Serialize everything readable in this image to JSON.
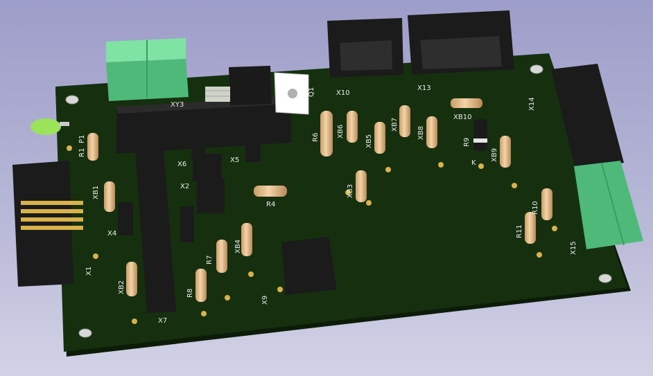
{
  "labels": {
    "X1": "X1",
    "X2": "X2",
    "X4": "X4",
    "X5": "X5",
    "X6": "X6",
    "X7": "X7",
    "X9": "X9",
    "X10": "X10",
    "X13": "X13",
    "X14": "X14",
    "X15": "X15",
    "R1": "R1",
    "P1": "P1",
    "R4": "R4",
    "R6": "R6",
    "R7": "R7",
    "R8": "R8",
    "R9": "R9",
    "R10": "R10",
    "R11": "R11",
    "Q1": "Q1",
    "K": "K",
    "XB1": "XB1",
    "XB2": "XB2",
    "XB3": "XB3",
    "XB4": "XB4",
    "XB5": "XB5",
    "XB6": "XB6",
    "XB7": "XB7",
    "XB8": "XB8",
    "XB9": "XB9",
    "XB10": "XB10",
    "XY3": "XY3"
  },
  "colors": {
    "background_top": "#9d9dc9",
    "board": "#16300f",
    "board_edge": "#0c1c08",
    "silkscreen": "#ececec",
    "connector_black": "#1b1b1b",
    "terminal_green": "#5fcf8a",
    "resistor_body": "#e7c192",
    "led_green": "#9be35a",
    "pad_gold": "#d9b24a"
  }
}
